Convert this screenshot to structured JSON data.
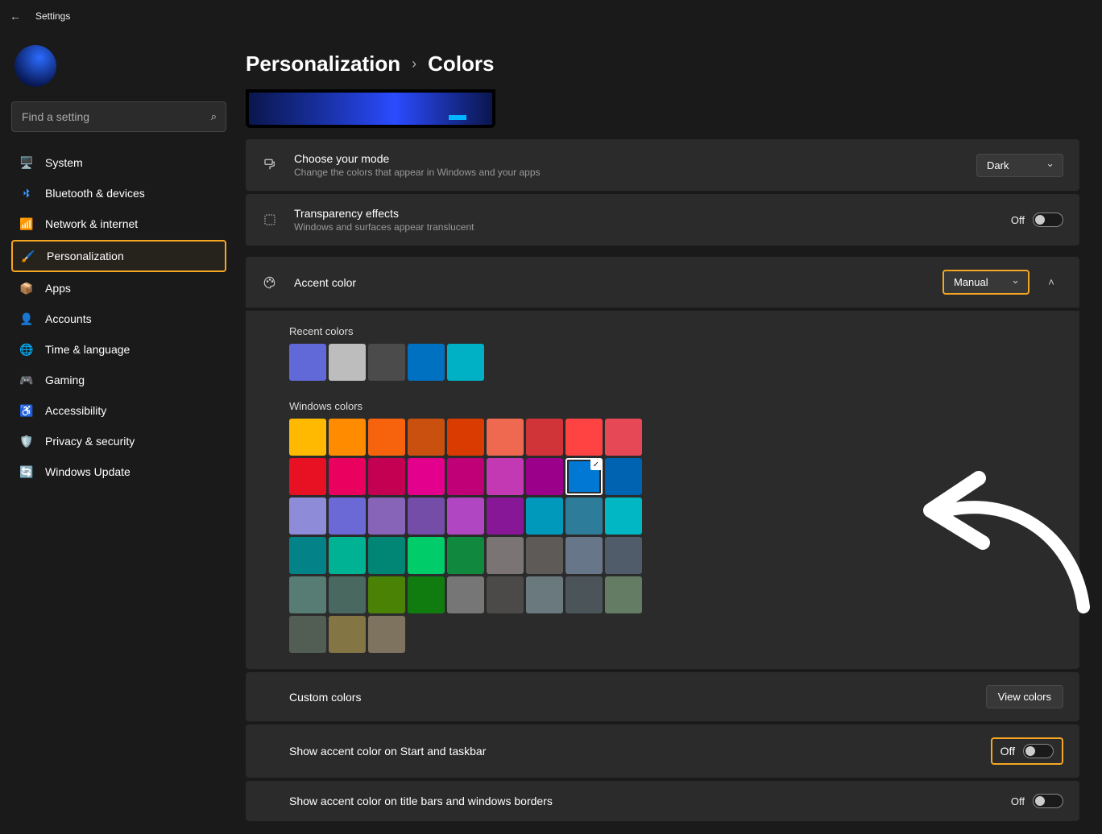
{
  "app_title": "Settings",
  "search_placeholder": "Find a setting",
  "nav": [
    {
      "label": "System",
      "icon": "🖥️"
    },
    {
      "label": "Bluetooth & devices",
      "icon": "bt"
    },
    {
      "label": "Network & internet",
      "icon": "📶"
    },
    {
      "label": "Personalization",
      "icon": "🖌️",
      "selected": true
    },
    {
      "label": "Apps",
      "icon": "📦"
    },
    {
      "label": "Accounts",
      "icon": "👤"
    },
    {
      "label": "Time & language",
      "icon": "🌐"
    },
    {
      "label": "Gaming",
      "icon": "🎮"
    },
    {
      "label": "Accessibility",
      "icon": "♿"
    },
    {
      "label": "Privacy & security",
      "icon": "🛡️"
    },
    {
      "label": "Windows Update",
      "icon": "🔄"
    }
  ],
  "breadcrumb": {
    "parent": "Personalization",
    "current": "Colors"
  },
  "mode_card": {
    "title": "Choose your mode",
    "desc": "Change the colors that appear in Windows and your apps",
    "value": "Dark"
  },
  "transparency_card": {
    "title": "Transparency effects",
    "desc": "Windows and surfaces appear translucent",
    "state": "Off"
  },
  "accent": {
    "title": "Accent color",
    "value": "Manual",
    "recent_label": "Recent colors",
    "recent": [
      "#6168d8",
      "#bdbdbd",
      "#4b4b4b",
      "#0070c0",
      "#00b0c4"
    ],
    "windows_label": "Windows colors",
    "windows": [
      [
        "#ffb900",
        "#ff8c00",
        "#f7630c",
        "#ca5010",
        "#da3b01",
        "#ef6950",
        "#d13438",
        "#ff4343",
        "#e74856"
      ],
      [
        "#e81123",
        "#ea005e",
        "#c30052",
        "#e3008c",
        "#bf0077",
        "#c239b3",
        "#9a0089",
        "#0078d4",
        "#0063b1"
      ],
      [
        "#8e8cd8",
        "#6b69d6",
        "#8764b8",
        "#744da9",
        "#b146c2",
        "#881798",
        "#0099bc",
        "#2d7d9a",
        "#00b7c3"
      ],
      [
        "#038387",
        "#00b294",
        "#018574",
        "#00cc6a",
        "#10893e",
        "#7a7574",
        "#5d5a58",
        "#68768a",
        "#515c6b"
      ],
      [
        "#567c73",
        "#486860",
        "#498205",
        "#107c10",
        "#767676",
        "#4c4a48",
        "#69797e",
        "#4a5459",
        "#647c64"
      ],
      [
        "#525e54",
        "#847545",
        "#7e735f"
      ]
    ],
    "selected_color": "#0078d4"
  },
  "custom_colors": {
    "label": "Custom colors",
    "button": "View colors"
  },
  "start_taskbar": {
    "label": "Show accent color on Start and taskbar",
    "state": "Off"
  },
  "title_bars": {
    "label": "Show accent color on title bars and windows borders",
    "state": "Off"
  }
}
